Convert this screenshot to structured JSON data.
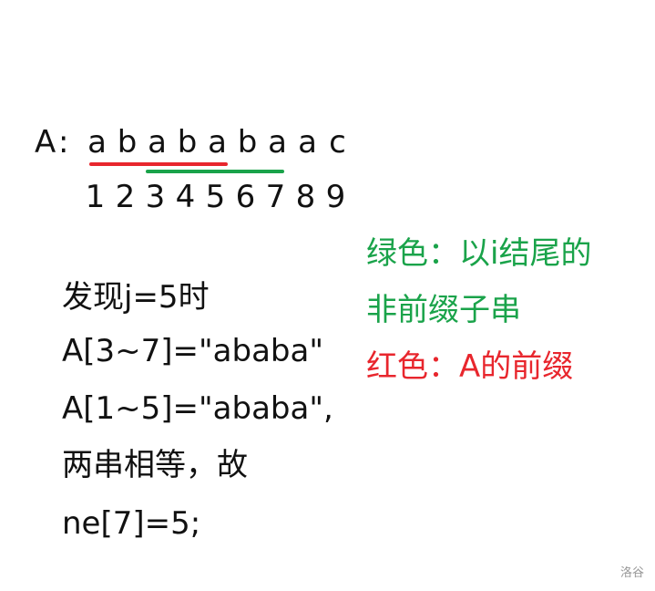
{
  "diagram": {
    "string_label": "A",
    "colon": ":",
    "chars": [
      "a",
      "b",
      "a",
      "b",
      "a",
      "b",
      "a",
      "a",
      "c"
    ],
    "indices": [
      "1",
      "2",
      "3",
      "4",
      "5",
      "6",
      "7",
      "8",
      "9"
    ],
    "highlights": {
      "red": {
        "from_index": 1,
        "to_index": 5,
        "color": "#e8262d"
      },
      "green": {
        "from_index": 3,
        "to_index": 7,
        "color": "#1aa34a"
      }
    }
  },
  "explanation": {
    "lines": [
      "发现j=5时",
      "A[3~7]=\"ababa\"",
      "A[1~5]=\"ababa\",",
      "两串相等，故",
      "ne[7]=5;"
    ]
  },
  "legend": {
    "green_line1": "绿色：以i结尾的",
    "green_line2": "非前缀子串",
    "red_line": "红色：A的前缀",
    "green_color": "#1aa34a",
    "red_color": "#e8262d"
  },
  "watermark": "洛谷"
}
